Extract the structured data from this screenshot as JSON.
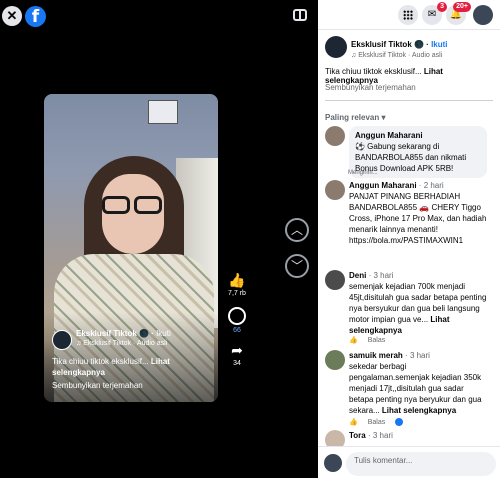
{
  "viewer": {
    "close_icon": "close-icon",
    "logo_letter": "f",
    "video": {
      "page_name": "Eksklusif Tiktok",
      "follow": "Ikuti",
      "audio": "Eksklusif Tiktok · Audio asli",
      "caption": "Tika chiuu tiktok eksklusif...",
      "see_more": "Lihat selengkapnya",
      "hide_translation": "Sembunyikan terjemahan"
    },
    "likes": "7,7 rb",
    "comments": "66",
    "shares": "34"
  },
  "topbar": {
    "messenger_badge": "3",
    "notif_badge": "20+"
  },
  "post": {
    "page_name": "Eksklusif Tiktok",
    "follow": "Ikuti",
    "audio": "Eksklusif Tiktok · Audio asli",
    "caption": "Tika chiuu tiktok eksklusif...",
    "see_more": "Lihat selengkapnya",
    "hide_translation": "Sembunyikan terjemahan",
    "sort_label": "Paling relevan"
  },
  "comments": [
    {
      "name": "Anggun Maharani",
      "time": "",
      "text": "⚽ Gabung sekarang di BANDARBOLA855 dan nikmati Bonus Download APK 5RB!",
      "status": "Mengirim...",
      "avatar_color": "#8a7b6e"
    },
    {
      "name": "Anggun Maharani",
      "time": "2 hari",
      "text": "PANJAT PINANG BERHADIAH BANDARBOLA855 🚗 CHERY Tiggo Cross, iPhone 17 Pro Max, dan hadiah menarik lainnya menanti! https://bola.mx/PASTIMAXWIN1",
      "avatar_color": "#8a7b6e"
    },
    {
      "name": "Deni",
      "time": "3 hari",
      "text": "semenjak kejadian 700k menjadi 45jt,disitulah gua sadar betapa penting nya bersyukur dan gua beli langsung motor impian gua ve...",
      "see_more": "Lihat selengkapnya",
      "avatar_color": "#4b4b4b"
    },
    {
      "name": "samuik merah",
      "time": "3 hari",
      "text": "sekedar berbagi pengalaman.semenjak kejadian 350k menjadi 17jt,,disitulah gua sadar betapa penting nya beryukur dan gua sekara...",
      "see_more": "Lihat selengkapnya",
      "avatar_color": "#6b7c5a"
    },
    {
      "name": "Tora",
      "time": "3 hari",
      "avatar_color": "#c9b8a8"
    }
  ],
  "actions": {
    "reply": "Balas"
  },
  "composer": {
    "placeholder": "Tulis komentar..."
  }
}
